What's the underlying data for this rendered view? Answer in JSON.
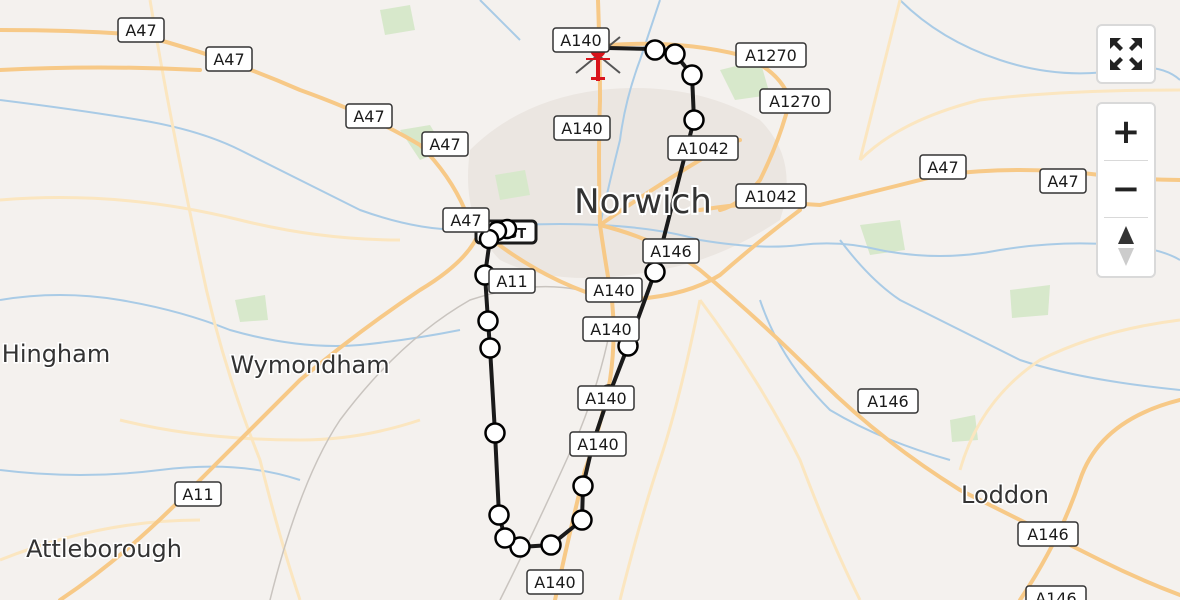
{
  "map": {
    "places": [
      {
        "name": "Norwich",
        "size": "large"
      },
      {
        "name": "Wymondham",
        "size": "medium"
      },
      {
        "name": "Hingham",
        "size": "medium"
      },
      {
        "name": "Attleborough",
        "size": "medium"
      },
      {
        "name": "Loddon",
        "size": "medium"
      }
    ],
    "road_shields": [
      "A47",
      "A47",
      "A47",
      "A47",
      "A47",
      "A47",
      "A47",
      "A140",
      "A140",
      "A140",
      "A140",
      "A140",
      "A140",
      "A140",
      "A1270",
      "A1270",
      "A1042",
      "A1042",
      "A11",
      "A11",
      "A146",
      "A146",
      "A146",
      "A146"
    ],
    "start_marker_text": "ST",
    "end_marker": "helicopter-icon"
  },
  "controls": {
    "fullscreen_icon": "fullscreen-icon",
    "zoom_in_label": "+",
    "zoom_out_label": "−",
    "compass_icon": "compass-icon"
  },
  "colors": {
    "route": "#1a1a1a",
    "waypoint_fill": "#ffffff",
    "road_major": "#f6c57a",
    "road_minor": "#fde3b0",
    "water": "#a9cbe6",
    "green": "#cfe3c2",
    "urban": "#e9e4df",
    "background": "#f4f1ee",
    "helicopter": "#d9141c"
  }
}
